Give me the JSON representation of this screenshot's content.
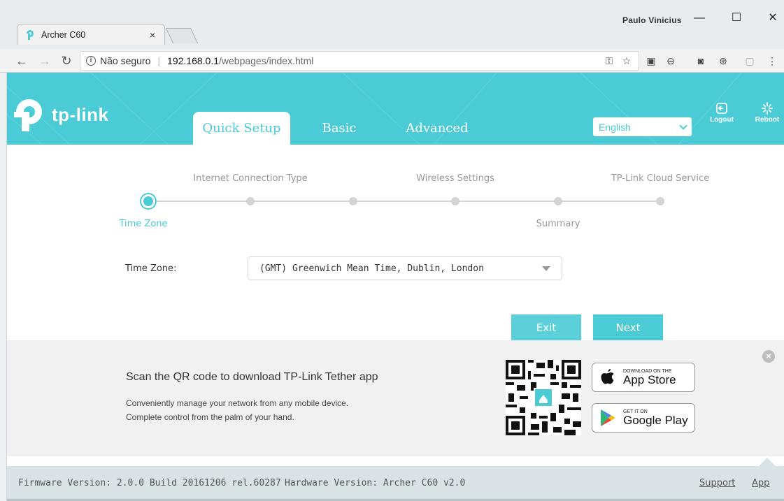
{
  "browser": {
    "tab_title": "Archer C60",
    "tab_close": "×",
    "user_name": "Paulo Vinicius",
    "minimize": "—",
    "maximize": "☐",
    "close": "✕",
    "url_security": "Não seguro",
    "url_host": "192.168.0.1",
    "url_path": "/webpages/index.html",
    "separator": "|"
  },
  "header": {
    "logo_text": "tp-link",
    "nav_tabs": [
      {
        "label": "Quick Setup",
        "active": true
      },
      {
        "label": "Basic",
        "active": false
      },
      {
        "label": "Advanced",
        "active": false
      }
    ],
    "language": "English",
    "logout_label": "Logout",
    "reboot_label": "Reboot"
  },
  "wizard": {
    "steps": [
      {
        "label": "Time Zone",
        "position": "below",
        "active": true
      },
      {
        "label": "Internet Connection Type",
        "position": "above",
        "active": false
      },
      {
        "label": "",
        "position": "below",
        "active": false
      },
      {
        "label": "Wireless Settings",
        "position": "above",
        "active": false
      },
      {
        "label": "Summary",
        "position": "below",
        "active": false
      },
      {
        "label": "TP-Link Cloud Service",
        "position": "above",
        "active": false
      }
    ],
    "timezone_label": "Time Zone:",
    "timezone_value": "(GMT) Greenwich Mean Time, Dublin, London",
    "exit_label": "Exit",
    "next_label": "Next"
  },
  "banner": {
    "title": "Scan the QR code to download TP-Link Tether app",
    "line1": "Conveniently manage your network from any mobile device.",
    "line2": "Complete control from the palm of your hand.",
    "appstore_small": "DOWNLOAD ON THE",
    "appstore_big": "App Store",
    "googleplay_small": "GET IT ON",
    "googleplay_big": "Google Play",
    "close_glyph": "×"
  },
  "footer": {
    "firmware": "Firmware Version: 2.0.0 Build 20161206 rel.60287",
    "hardware": "Hardware Version: Archer C60 v2.0",
    "support": "Support",
    "app": "App"
  },
  "colors": {
    "brand": "#4acbd6",
    "banner_bg": "#f1f1f1",
    "footer_bg": "#d9e2e5"
  }
}
